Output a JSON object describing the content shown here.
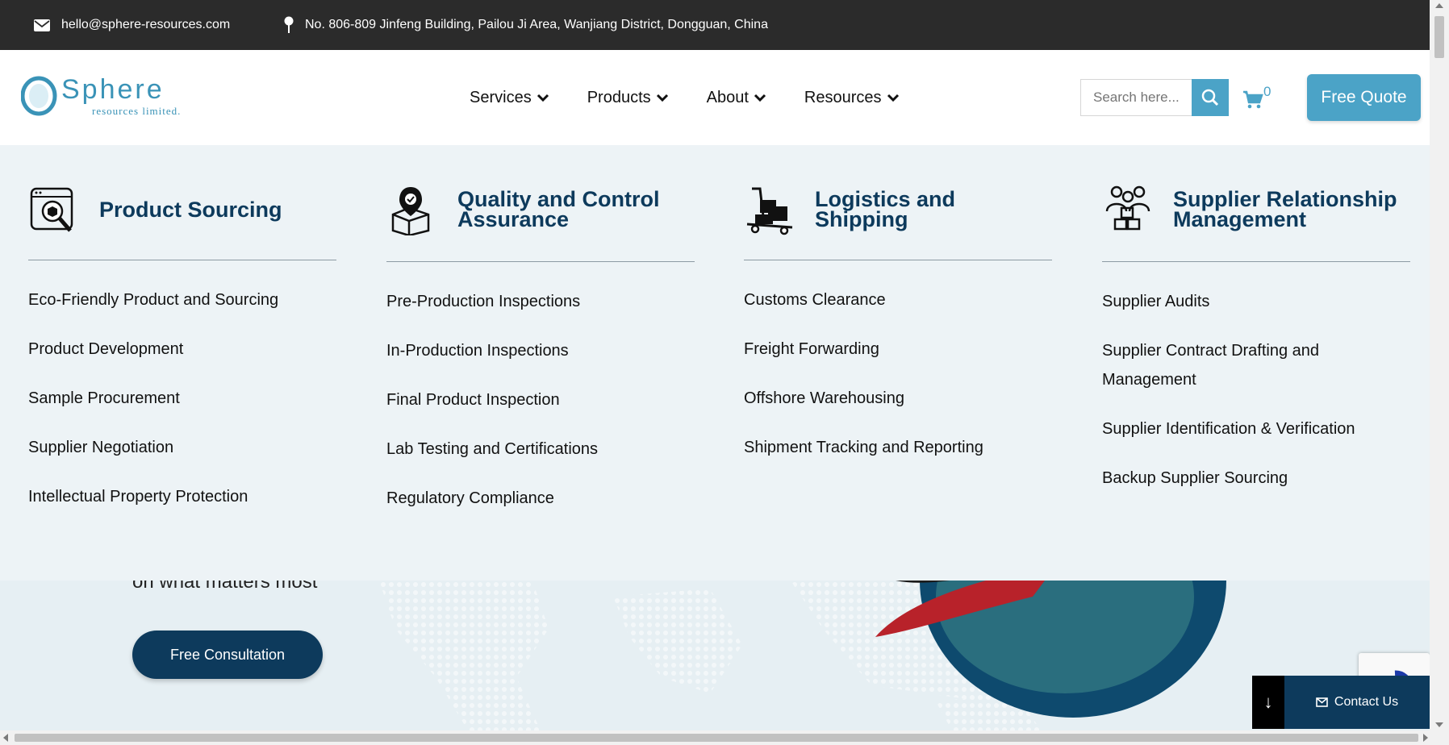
{
  "topbar": {
    "email": "hello@sphere-resources.com",
    "address": "No. 806-809 Jinfeng Building, Pailou Ji Area, Wanjiang District, Dongguan, China",
    "email_icon": "envelope-icon",
    "address_icon": "map-pin-icon"
  },
  "header": {
    "logo_word": "Sphere",
    "logo_sub": "resources limited.",
    "nav": [
      {
        "label": "Services"
      },
      {
        "label": "Products"
      },
      {
        "label": "About"
      },
      {
        "label": "Resources"
      }
    ],
    "search_placeholder": "Search here...",
    "cart_count": "0",
    "quote_label": "Free Quote"
  },
  "mega_menu": {
    "columns": [
      {
        "title": "Product Sourcing",
        "icon": "product-sourcing-icon",
        "links": [
          "Eco-Friendly Product and Sourcing",
          "Product Development",
          "Sample Procurement",
          "Supplier Negotiation",
          "Intellectual Property Protection"
        ]
      },
      {
        "title": "Quality and Control Assurance",
        "icon": "quality-control-icon",
        "links": [
          "Pre-Production Inspections",
          "In-Production Inspections",
          "Final Product Inspection",
          "Lab Testing and Certifications",
          "Regulatory Compliance"
        ]
      },
      {
        "title": "Logistics and Shipping",
        "icon": "logistics-icon",
        "links": [
          "Customs Clearance",
          "Freight Forwarding",
          "Offshore Warehousing",
          "Shipment Tracking and Reporting"
        ]
      },
      {
        "title": "Supplier Relationship Management",
        "icon": "supplier-relationship-icon",
        "links": [
          "Supplier Audits",
          "Supplier Contract Drafting and Management",
          "Supplier Identification & Verification",
          "Backup Supplier Sourcing"
        ]
      }
    ]
  },
  "hero": {
    "partial_text": "on what matters most",
    "consult_label": "Free Consultation"
  },
  "contact_widget": {
    "label": "Contact Us",
    "arrow": "↓"
  },
  "colors": {
    "navy": "#0d3a5c",
    "accent": "#4ba3c7",
    "topbar": "#2b2b2b",
    "mega_bg": "#edf3f6"
  }
}
